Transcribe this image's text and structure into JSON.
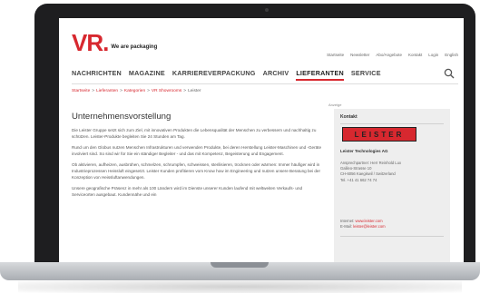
{
  "site": {
    "logo_mark": "VR.",
    "logo_tagline": "We are packaging"
  },
  "top_nav": [
    "Startseite",
    "Newsletter",
    "Abo/Angebote",
    "Kontakt",
    "Login",
    "English"
  ],
  "main_nav": [
    {
      "label": "NACHRICHTEN",
      "active": false
    },
    {
      "label": "MAGAZINE",
      "active": false
    },
    {
      "label": "KARRIEREVERPACKUNG",
      "active": false
    },
    {
      "label": "ARCHIV",
      "active": false
    },
    {
      "label": "LIEFERANTEN",
      "active": true
    },
    {
      "label": "SERVICE",
      "active": false
    }
  ],
  "breadcrumb": [
    "Startseite",
    ">",
    "Lieferanten",
    ">",
    "Kategorien",
    ">",
    "VR Showrooms",
    ">",
    "Leister"
  ],
  "ad_label": "Anzeige",
  "content": {
    "title": "Unternehmensvorstellung",
    "p1": "Die Leister Gruppe setzt sich zum Ziel, mit innovativen Produkten die Lebensqualität der Menschen zu verbessern und nachhaltig zu schützen. Leister-Produkte begleiten Sie 24 Stunden am Tag.",
    "p2": "Rund um den Globus nutzen Menschen Infrastrukturen und verwenden Produkte, bei deren Herstellung Leister-Maschinen und -Geräte involviert sind. So sind wir für Sie ein ständiger Begleiter - und das mit Kompetenz, Begeisterung und Engagement.",
    "p3": "Ob aktivieren, aufheizen, ausbrühen, schmelzen, schrumpfen, schweissen, sterilisieren, trocknen oder wärmen: Immer häufiger wird in Industrieprozessen Heissluft eingesetzt. Leister Kunden profitieren vom Know how im Engineering und nutzen unsere Beratung bei der Konzeption von Heissluftanwendungen.",
    "p4": "Unsere geografische Präsenz in mehr als 100 Ländern wird im Dienste unserer Kunden laufend mit weltweiten Verkaufs- und Serviceorten ausgebaut. Kundennähe und ein"
  },
  "sidebar": {
    "title": "Kontakt",
    "brand_logo": "LEISTER",
    "company": "Leister Technologies AG",
    "address": [
      "Ansprechpartner: Herr Reinhold Lux",
      "Galileo-Strasse 10",
      "CH-6056 Kaegiswil / Switzerland",
      "Tel. +41 41 662 74 74"
    ],
    "internet_label": "Internet:",
    "internet_value": "www.leister.com",
    "email_label": "E-Mail:",
    "email_value": "leister@leister.com"
  },
  "colors": {
    "brand_red": "#d7282f",
    "laptop_bezel": "#1e1e20",
    "sidebar_bg": "#eeeeee"
  }
}
